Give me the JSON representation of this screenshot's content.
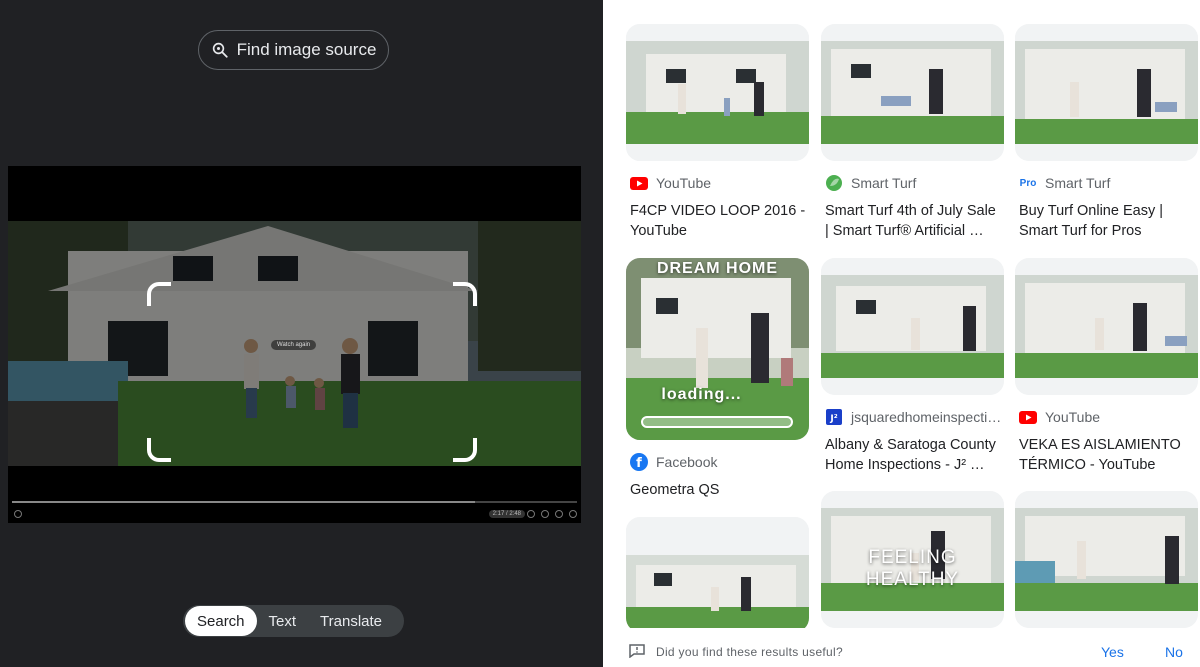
{
  "left_pane": {
    "find_source_label": "Find image source",
    "video_overlay": {
      "watch_again": "Watch again",
      "time": "2:17 / 2:48",
      "progress": 0.82
    },
    "modes": [
      {
        "label": "Search",
        "active": true
      },
      {
        "label": "Text",
        "active": false
      },
      {
        "label": "Translate",
        "active": false
      }
    ]
  },
  "results": [
    {
      "source": "YouTube",
      "source_icon": "youtube-icon",
      "title": "F4CP VIDEO LOOP 2016 - YouTube"
    },
    {
      "source": "Smart Turf",
      "source_icon": "smart-turf-leaf-icon",
      "title": "Smart Turf 4th of July Sale | Smart Turf® Artificial …"
    },
    {
      "source": "Smart Turf",
      "source_icon": "pro-icon",
      "source_icon_text": "Pro",
      "title": "Buy Turf Online Easy | Smart Turf for Pros"
    },
    {
      "source": "Facebook",
      "source_icon": "facebook-icon",
      "title": "Geometra QS",
      "overlay_top": "DREAM HOME",
      "overlay_bottom": "loading..."
    },
    {
      "source": "jsquaredhomeinspecti…",
      "source_icon": "jsquared-icon",
      "title": "Albany & Saratoga County Home Inspections - J² …"
    },
    {
      "source": "YouTube",
      "source_icon": "youtube-icon",
      "title": "VEKA ES AISLAMIENTO TÉRMICO - YouTube"
    },
    {
      "overlay_center": "FEELING HEALTHY"
    }
  ],
  "feedback": {
    "question": "Did you find these results useful?",
    "yes": "Yes",
    "no": "No"
  },
  "colors": {
    "accent": "#1a73e8",
    "dark_bg": "#202124",
    "youtube": "#ff0000",
    "facebook": "#1877f2"
  }
}
